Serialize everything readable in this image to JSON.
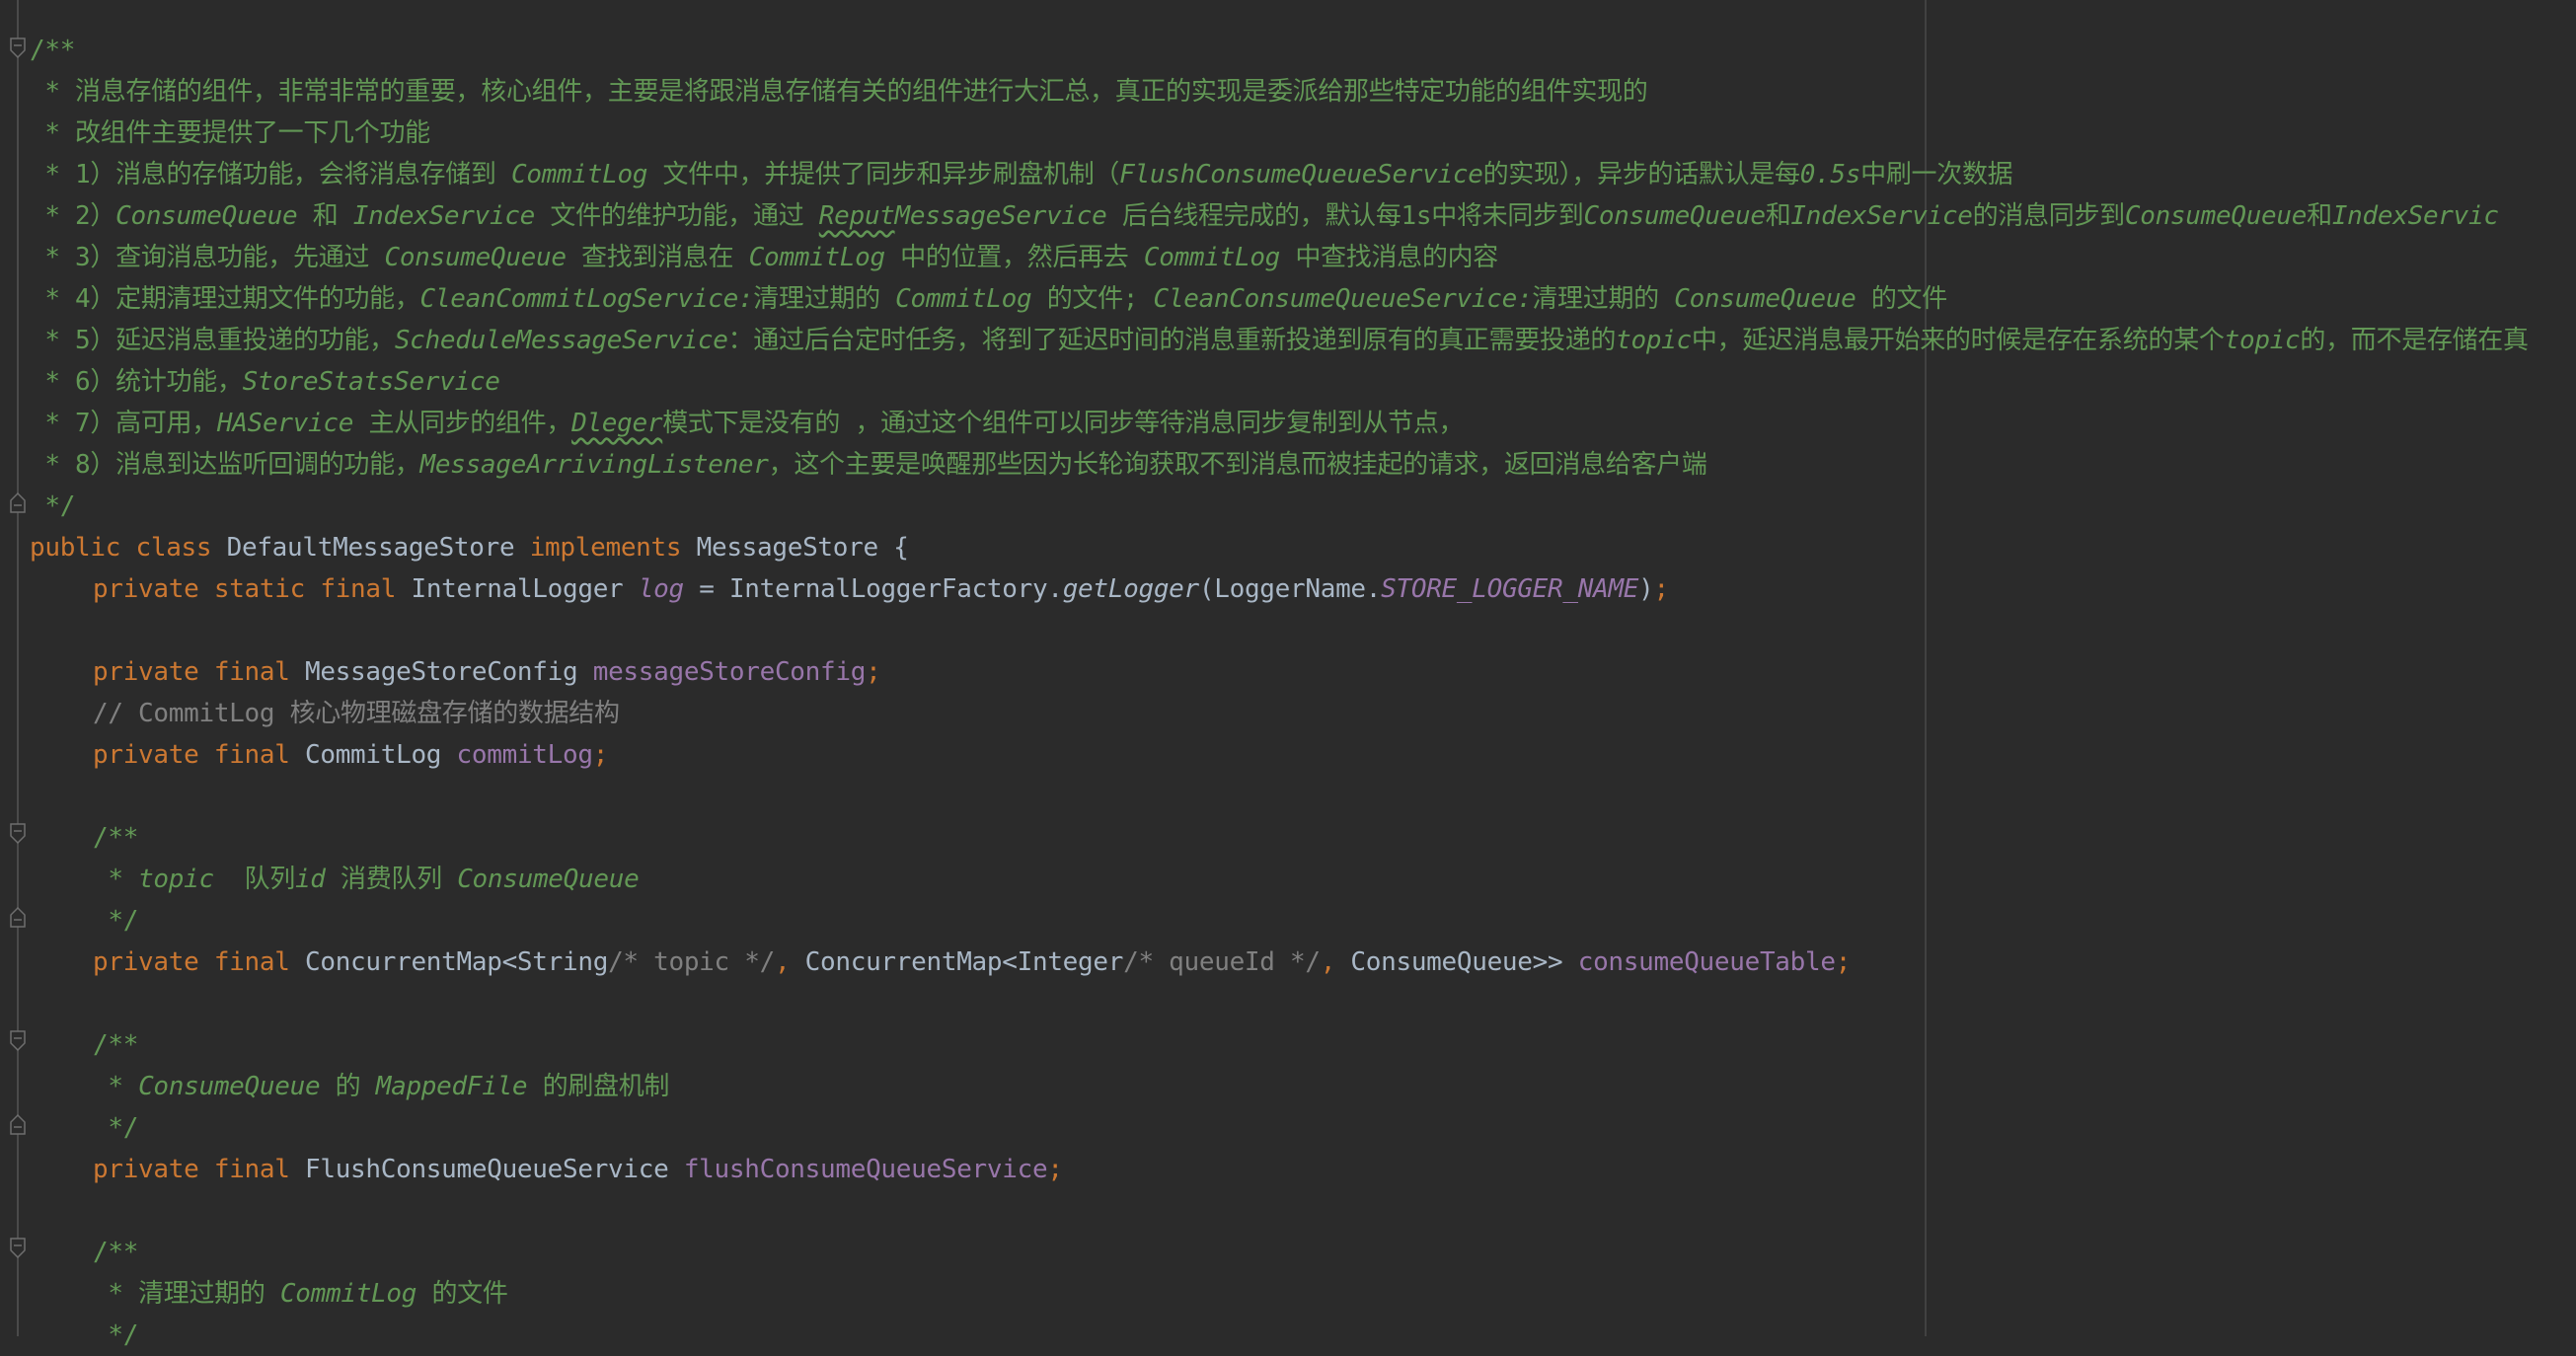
{
  "editor": {
    "class_doc": {
      "open": "/**",
      "lines": [
        {
          "text": " * 消息存储的组件，非常非常的重要，核心组件，主要是将跟消息存储有关的组件进行大汇总，真正的实现是委派给那些特定功能的组件实现的"
        },
        {
          "text": " * 改组件主要提供了一下几个功能"
        },
        {
          "p1": " * 1）消息的存储功能，会将消息存储到 ",
          "i1": "CommitLog",
          "p2": " 文件中，并提供了同步和异步刷盘机制（",
          "i2": "FlushConsumeQueueService",
          "p3": "的实现），异步的话默认是每",
          "i3": "0.5s",
          "p4": "中刷一次数据"
        },
        {
          "p1": " * 2）",
          "i1": "ConsumeQueue",
          "p2": " 和 ",
          "i2": "IndexService",
          "p3": " 文件的维护功能，通过 ",
          "typo": "Reput",
          "i3": "MessageService",
          "p4": " 后台线程完成的，默认每1s中将未同步到",
          "i4": "ConsumeQueue",
          "p5": "和",
          "i5": "IndexService",
          "p6": "的消息同步到",
          "i6": "ConsumeQueue",
          "p7": "和",
          "i7": "IndexServic"
        },
        {
          "p1": " * 3）查询消息功能，先通过 ",
          "i1": "ConsumeQueue",
          "p2": " 查找到消息在 ",
          "i2": "CommitLog",
          "p3": " 中的位置，然后再去 ",
          "i3": "CommitLog",
          "p4": " 中查找消息的内容"
        },
        {
          "p1": " * 4）定期清理过期文件的功能，",
          "i1": "CleanCommitLogService:",
          "p2": "清理过期的 ",
          "i2": "CommitLog",
          "p3": " 的文件; ",
          "i3": "CleanConsumeQueueService:",
          "p4": "清理过期的 ",
          "i4": "ConsumeQueue",
          "p5": " 的文件"
        },
        {
          "p1": " * 5）延迟消息重投递的功能，",
          "i1": "ScheduleMessageService",
          "p2": "：通过后台定时任务，将到了延迟时间的消息重新投递到原有的真正需要投递的",
          "i2": "topic",
          "p3": "中，延迟消息最开始来的时候是存在系统的某个",
          "i3": "topic",
          "p4": "的，而不是存储在真"
        },
        {
          "p1": " * 6）统计功能，",
          "i1": "StoreStatsService"
        },
        {
          "p1": " * 7）高可用，",
          "i1": "HAService",
          "p2": " 主从同步的组件，",
          "typo": "Dleger",
          "p3": "模式下是没有的 ，通过这个组件可以同步等待消息同步复制到从节点，"
        },
        {
          "p1": " * 8）消息到达监听回调的功能，",
          "i1": "MessageArrivingListener",
          "p2": "，这个主要是唤醒那些因为长轮询获取不到消息而被挂起的请求，返回消息给客户端"
        }
      ],
      "close": " */"
    },
    "class_decl": {
      "kw1": "public",
      "kw2": "class",
      "name": "DefaultMessageStore",
      "kw3": "implements",
      "iface": "MessageStore",
      "brace": "{"
    },
    "log_field": {
      "kw1": "private",
      "kw2": "static",
      "kw3": "final",
      "type": "InternalLogger",
      "name": "log",
      "eq": "=",
      "factory": "InternalLoggerFactory.",
      "method": "getLogger",
      "arg_open": "(LoggerName.",
      "const": "STORE_LOGGER_NAME",
      "arg_close": ")",
      "semi": ";"
    },
    "config_field": {
      "kw1": "private",
      "kw2": "final",
      "type": "MessageStoreConfig",
      "name": "messageStoreConfig",
      "semi": ";"
    },
    "commitlog_comment": "// CommitLog 核心物理磁盘存储的数据结构",
    "commitlog_field": {
      "kw1": "private",
      "kw2": "final",
      "type": "CommitLog",
      "name": "commitLog",
      "semi": ";"
    },
    "cq_doc": {
      "open": "/**",
      "star": " * ",
      "i1": "topic",
      "p1": "  队列",
      "i2": "id",
      "p2": " 消费队列 ",
      "i3": "ConsumeQueue",
      "close": " */"
    },
    "cq_field": {
      "kw1": "private",
      "kw2": "final",
      "t1": "ConcurrentMap<String",
      "c1": "/* topic */",
      "comma1": ",",
      "t2": " ConcurrentMap<Integer",
      "c2": "/* queueId */",
      "comma2": ",",
      "t3": " ConsumeQueue>>",
      "name": "consumeQueueTable",
      "semi": ";"
    },
    "flush_doc": {
      "open": "/**",
      "star": " * ",
      "i1": "ConsumeQueue",
      "p1": " 的 ",
      "i2": "MappedFile",
      "p2": " 的刷盘机制",
      "close": " */"
    },
    "flush_field": {
      "kw1": "private",
      "kw2": "final",
      "type": "FlushConsumeQueueService",
      "name": "flushConsumeQueueService",
      "semi": ";"
    },
    "clean_doc": {
      "open": "/**",
      "star": " * ",
      "p1": "清理过期的 ",
      "i1": "CommitLog",
      "p2": " 的文件",
      "close": " */"
    }
  }
}
